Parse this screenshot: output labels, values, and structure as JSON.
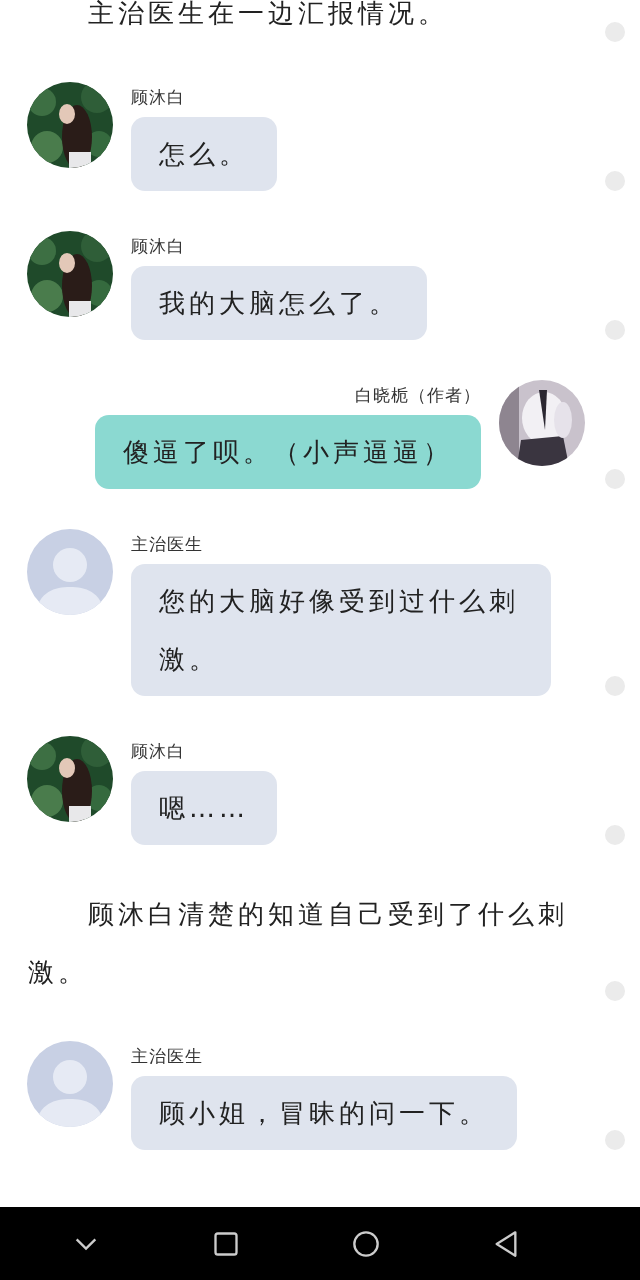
{
  "entries": [
    {
      "kind": "narration",
      "text": "主治医生在一边汇报情况。"
    },
    {
      "kind": "left",
      "name": "顾沐白",
      "text": "怎么。"
    },
    {
      "kind": "left",
      "name": "顾沐白",
      "text": "我的大脑怎么了。"
    },
    {
      "kind": "right",
      "name": "白晓栀（作者）",
      "text": "傻逼了呗。（小声逼逼）"
    },
    {
      "kind": "left",
      "name": "主治医生",
      "avatar": {
        "kind": "placeholder"
      },
      "text": "您的大脑好像受到过什么刺激。"
    },
    {
      "kind": "left",
      "name": "顾沐白",
      "text": "嗯……"
    },
    {
      "kind": "narration",
      "text": "顾沐白清楚的知道自己受到了什么刺激。"
    },
    {
      "kind": "left",
      "name": "主治医生",
      "avatar": {
        "kind": "placeholder"
      },
      "text": "顾小姐，冒昧的问一下。"
    }
  ]
}
